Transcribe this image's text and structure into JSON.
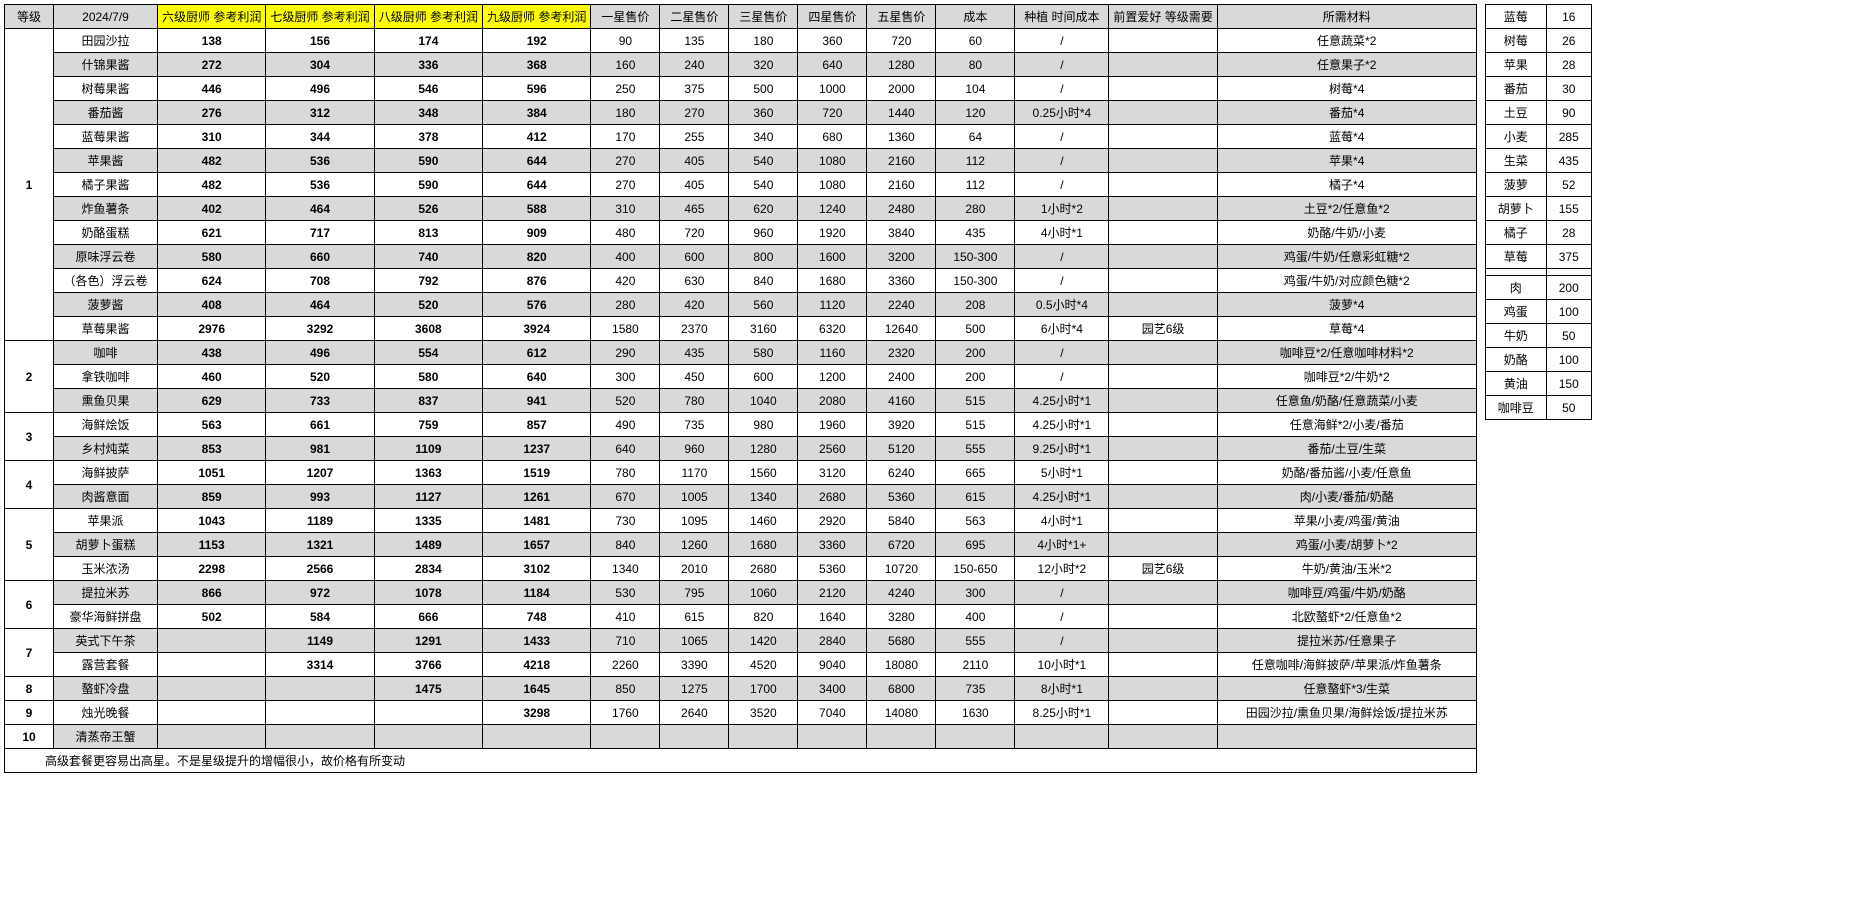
{
  "headers": {
    "level": "等级",
    "date": "2024/7/9",
    "profit6": "六级厨师\n参考利润",
    "profit7": "七级厨师\n参考利润",
    "profit8": "八级厨师\n参考利润",
    "profit9": "九级厨师\n参考利润",
    "star1": "一星售价",
    "star2": "二星售价",
    "star3": "三星售价",
    "star4": "四星售价",
    "star5": "五星售价",
    "cost": "成本",
    "plant": "种植\n时间成本",
    "prereq": "前置爱好\n等级需要",
    "materials": "所需材料"
  },
  "rows": [
    {
      "level": "1",
      "name": "田园沙拉",
      "p6": "138",
      "p7": "156",
      "p8": "174",
      "p9": "192",
      "s1": "90",
      "s2": "135",
      "s3": "180",
      "s4": "360",
      "s5": "720",
      "cost": "60",
      "plant": "/",
      "prereq": "",
      "mat": "任意蔬菜*2",
      "shade": false
    },
    {
      "level": "",
      "name": "什锦果酱",
      "p6": "272",
      "p7": "304",
      "p8": "336",
      "p9": "368",
      "s1": "160",
      "s2": "240",
      "s3": "320",
      "s4": "640",
      "s5": "1280",
      "cost": "80",
      "plant": "/",
      "prereq": "",
      "mat": "任意果子*2",
      "shade": true
    },
    {
      "level": "",
      "name": "树莓果酱",
      "p6": "446",
      "p7": "496",
      "p8": "546",
      "p9": "596",
      "s1": "250",
      "s2": "375",
      "s3": "500",
      "s4": "1000",
      "s5": "2000",
      "cost": "104",
      "plant": "/",
      "prereq": "",
      "mat": "树莓*4",
      "shade": false
    },
    {
      "level": "",
      "name": "番茄酱",
      "p6": "276",
      "p7": "312",
      "p8": "348",
      "p9": "384",
      "s1": "180",
      "s2": "270",
      "s3": "360",
      "s4": "720",
      "s5": "1440",
      "cost": "120",
      "plant": "0.25小时*4",
      "prereq": "",
      "mat": "番茄*4",
      "shade": true
    },
    {
      "level": "",
      "name": "蓝莓果酱",
      "p6": "310",
      "p7": "344",
      "p8": "378",
      "p9": "412",
      "s1": "170",
      "s2": "255",
      "s3": "340",
      "s4": "680",
      "s5": "1360",
      "cost": "64",
      "plant": "/",
      "prereq": "",
      "mat": "蓝莓*4",
      "shade": false
    },
    {
      "level": "",
      "name": "苹果酱",
      "p6": "482",
      "p7": "536",
      "p8": "590",
      "p9": "644",
      "s1": "270",
      "s2": "405",
      "s3": "540",
      "s4": "1080",
      "s5": "2160",
      "cost": "112",
      "plant": "/",
      "prereq": "",
      "mat": "苹果*4",
      "shade": true
    },
    {
      "level": "",
      "name": "橘子果酱",
      "p6": "482",
      "p7": "536",
      "p8": "590",
      "p9": "644",
      "s1": "270",
      "s2": "405",
      "s3": "540",
      "s4": "1080",
      "s5": "2160",
      "cost": "112",
      "plant": "/",
      "prereq": "",
      "mat": "橘子*4",
      "shade": false
    },
    {
      "level": "",
      "name": "炸鱼薯条",
      "p6": "402",
      "p7": "464",
      "p8": "526",
      "p9": "588",
      "s1": "310",
      "s2": "465",
      "s3": "620",
      "s4": "1240",
      "s5": "2480",
      "cost": "280",
      "plant": "1小时*2",
      "prereq": "",
      "mat": "土豆*2/任意鱼*2",
      "shade": true
    },
    {
      "level": "",
      "name": "奶酪蛋糕",
      "p6": "621",
      "p7": "717",
      "p8": "813",
      "p9": "909",
      "s1": "480",
      "s2": "720",
      "s3": "960",
      "s4": "1920",
      "s5": "3840",
      "cost": "435",
      "plant": "4小时*1",
      "prereq": "",
      "mat": "奶酪/牛奶/小麦",
      "shade": false
    },
    {
      "level": "",
      "name": "原味浮云卷",
      "p6": "580",
      "p7": "660",
      "p8": "740",
      "p9": "820",
      "s1": "400",
      "s2": "600",
      "s3": "800",
      "s4": "1600",
      "s5": "3200",
      "cost": "150-300",
      "plant": "/",
      "prereq": "",
      "mat": "鸡蛋/牛奶/任意彩虹糖*2",
      "shade": true
    },
    {
      "level": "",
      "name": "（各色）浮云卷",
      "p6": "624",
      "p7": "708",
      "p8": "792",
      "p9": "876",
      "s1": "420",
      "s2": "630",
      "s3": "840",
      "s4": "1680",
      "s5": "3360",
      "cost": "150-300",
      "plant": "/",
      "prereq": "",
      "mat": "鸡蛋/牛奶/对应颜色糖*2",
      "shade": false
    },
    {
      "level": "",
      "name": "菠萝酱",
      "p6": "408",
      "p7": "464",
      "p8": "520",
      "p9": "576",
      "s1": "280",
      "s2": "420",
      "s3": "560",
      "s4": "1120",
      "s5": "2240",
      "cost": "208",
      "plant": "0.5小时*4",
      "prereq": "",
      "mat": "菠萝*4",
      "shade": true
    },
    {
      "level": "",
      "name": "草莓果酱",
      "p6": "2976",
      "p7": "3292",
      "p8": "3608",
      "p9": "3924",
      "s1": "1580",
      "s2": "2370",
      "s3": "3160",
      "s4": "6320",
      "s5": "12640",
      "cost": "500",
      "plant": "6小时*4",
      "prereq": "园艺6级",
      "mat": "草莓*4",
      "shade": false
    },
    {
      "level": "2",
      "name": "咖啡",
      "p6": "438",
      "p7": "496",
      "p8": "554",
      "p9": "612",
      "s1": "290",
      "s2": "435",
      "s3": "580",
      "s4": "1160",
      "s5": "2320",
      "cost": "200",
      "plant": "/",
      "prereq": "",
      "mat": "咖啡豆*2/任意咖啡材料*2",
      "shade": true
    },
    {
      "level": "",
      "name": "拿铁咖啡",
      "p6": "460",
      "p7": "520",
      "p8": "580",
      "p9": "640",
      "s1": "300",
      "s2": "450",
      "s3": "600",
      "s4": "1200",
      "s5": "2400",
      "cost": "200",
      "plant": "/",
      "prereq": "",
      "mat": "咖啡豆*2/牛奶*2",
      "shade": false
    },
    {
      "level": "",
      "name": "熏鱼贝果",
      "p6": "629",
      "p7": "733",
      "p8": "837",
      "p9": "941",
      "s1": "520",
      "s2": "780",
      "s3": "1040",
      "s4": "2080",
      "s5": "4160",
      "cost": "515",
      "plant": "4.25小时*1",
      "prereq": "",
      "mat": "任意鱼/奶酪/任意蔬菜/小麦",
      "shade": true
    },
    {
      "level": "3",
      "name": "海鲜烩饭",
      "p6": "563",
      "p7": "661",
      "p8": "759",
      "p9": "857",
      "s1": "490",
      "s2": "735",
      "s3": "980",
      "s4": "1960",
      "s5": "3920",
      "cost": "515",
      "plant": "4.25小时*1",
      "prereq": "",
      "mat": "任意海鲜*2/小麦/番茄",
      "shade": false
    },
    {
      "level": "",
      "name": "乡村炖菜",
      "p6": "853",
      "p7": "981",
      "p8": "1109",
      "p9": "1237",
      "s1": "640",
      "s2": "960",
      "s3": "1280",
      "s4": "2560",
      "s5": "5120",
      "cost": "555",
      "plant": "9.25小时*1",
      "prereq": "",
      "mat": "番茄/土豆/生菜",
      "shade": true
    },
    {
      "level": "4",
      "name": "海鲜披萨",
      "p6": "1051",
      "p7": "1207",
      "p8": "1363",
      "p9": "1519",
      "s1": "780",
      "s2": "1170",
      "s3": "1560",
      "s4": "3120",
      "s5": "6240",
      "cost": "665",
      "plant": "5小时*1",
      "prereq": "",
      "mat": "奶酪/番茄酱/小麦/任意鱼",
      "shade": false
    },
    {
      "level": "",
      "name": "肉酱意面",
      "p6": "859",
      "p7": "993",
      "p8": "1127",
      "p9": "1261",
      "s1": "670",
      "s2": "1005",
      "s3": "1340",
      "s4": "2680",
      "s5": "5360",
      "cost": "615",
      "plant": "4.25小时*1",
      "prereq": "",
      "mat": "肉/小麦/番茄/奶酪",
      "shade": true
    },
    {
      "level": "5",
      "name": "苹果派",
      "p6": "1043",
      "p7": "1189",
      "p8": "1335",
      "p9": "1481",
      "s1": "730",
      "s2": "1095",
      "s3": "1460",
      "s4": "2920",
      "s5": "5840",
      "cost": "563",
      "plant": "4小时*1",
      "prereq": "",
      "mat": "苹果/小麦/鸡蛋/黄油",
      "shade": false
    },
    {
      "level": "",
      "name": "胡萝卜蛋糕",
      "p6": "1153",
      "p7": "1321",
      "p8": "1489",
      "p9": "1657",
      "s1": "840",
      "s2": "1260",
      "s3": "1680",
      "s4": "3360",
      "s5": "6720",
      "cost": "695",
      "plant": "4小时*1+",
      "prereq": "",
      "mat": "鸡蛋/小麦/胡萝卜*2",
      "shade": true
    },
    {
      "level": "",
      "name": "玉米浓汤",
      "p6": "2298",
      "p7": "2566",
      "p8": "2834",
      "p9": "3102",
      "s1": "1340",
      "s2": "2010",
      "s3": "2680",
      "s4": "5360",
      "s5": "10720",
      "cost": "150-650",
      "plant": "12小时*2",
      "prereq": "园艺6级",
      "mat": "牛奶/黄油/玉米*2",
      "shade": false
    },
    {
      "level": "6",
      "name": "提拉米苏",
      "p6": "866",
      "p7": "972",
      "p8": "1078",
      "p9": "1184",
      "s1": "530",
      "s2": "795",
      "s3": "1060",
      "s4": "2120",
      "s5": "4240",
      "cost": "300",
      "plant": "/",
      "prereq": "",
      "mat": "咖啡豆/鸡蛋/牛奶/奶酪",
      "shade": true
    },
    {
      "level": "",
      "name": "豪华海鲜拼盘",
      "p6": "502",
      "p7": "584",
      "p8": "666",
      "p9": "748",
      "s1": "410",
      "s2": "615",
      "s3": "820",
      "s4": "1640",
      "s5": "3280",
      "cost": "400",
      "plant": "/",
      "prereq": "",
      "mat": "北欧螯虾*2/任意鱼*2",
      "shade": false
    },
    {
      "level": "7",
      "name": "英式下午茶",
      "p6": "",
      "p7": "1149",
      "p8": "1291",
      "p9": "1433",
      "s1": "710",
      "s2": "1065",
      "s3": "1420",
      "s4": "2840",
      "s5": "5680",
      "cost": "555",
      "plant": "/",
      "prereq": "",
      "mat": "提拉米苏/任意果子",
      "shade": true
    },
    {
      "level": "",
      "name": "露营套餐",
      "p6": "",
      "p7": "3314",
      "p8": "3766",
      "p9": "4218",
      "s1": "2260",
      "s2": "3390",
      "s3": "4520",
      "s4": "9040",
      "s5": "18080",
      "cost": "2110",
      "plant": "10小时*1",
      "prereq": "",
      "mat": "任意咖啡/海鲜披萨/苹果派/炸鱼薯条",
      "shade": false
    },
    {
      "level": "8",
      "name": "螯虾冷盘",
      "p6": "",
      "p7": "",
      "p8": "1475",
      "p9": "1645",
      "s1": "850",
      "s2": "1275",
      "s3": "1700",
      "s4": "3400",
      "s5": "6800",
      "cost": "735",
      "plant": "8小时*1",
      "prereq": "",
      "mat": "任意螯虾*3/生菜",
      "shade": true
    },
    {
      "level": "9",
      "name": "烛光晚餐",
      "p6": "",
      "p7": "",
      "p8": "",
      "p9": "3298",
      "s1": "1760",
      "s2": "2640",
      "s3": "3520",
      "s4": "7040",
      "s5": "14080",
      "cost": "1630",
      "plant": "8.25小时*1",
      "prereq": "",
      "mat": "田园沙拉/熏鱼贝果/海鲜烩饭/提拉米苏",
      "shade": false
    },
    {
      "level": "10",
      "name": "清蒸帝王蟹",
      "p6": "",
      "p7": "",
      "p8": "",
      "p9": "",
      "s1": "",
      "s2": "",
      "s3": "",
      "s4": "",
      "s5": "",
      "cost": "",
      "plant": "",
      "prereq": "",
      "mat": "",
      "shade": true
    }
  ],
  "note": "高级套餐更容易出高星。不是星级提升的增幅很小，故价格有所变动",
  "side_items": [
    {
      "name": "蓝莓",
      "val": "16"
    },
    {
      "name": "树莓",
      "val": "26"
    },
    {
      "name": "苹果",
      "val": "28"
    },
    {
      "name": "番茄",
      "val": "30"
    },
    {
      "name": "土豆",
      "val": "90"
    },
    {
      "name": "小麦",
      "val": "285"
    },
    {
      "name": "生菜",
      "val": "435"
    },
    {
      "name": "菠萝",
      "val": "52"
    },
    {
      "name": "胡萝卜",
      "val": "155"
    },
    {
      "name": "橘子",
      "val": "28"
    },
    {
      "name": "草莓",
      "val": "375"
    },
    {
      "name": "",
      "val": ""
    },
    {
      "name": "肉",
      "val": "200"
    },
    {
      "name": "鸡蛋",
      "val": "100"
    },
    {
      "name": "牛奶",
      "val": "50"
    },
    {
      "name": "奶酪",
      "val": "100"
    },
    {
      "name": "黄油",
      "val": "150"
    },
    {
      "name": "咖啡豆",
      "val": "50"
    }
  ],
  "level_spans": {
    "1": 13,
    "2": 3,
    "3": 2,
    "4": 2,
    "5": 3,
    "6": 2,
    "7": 2,
    "8": 1,
    "9": 1,
    "10": 1
  }
}
